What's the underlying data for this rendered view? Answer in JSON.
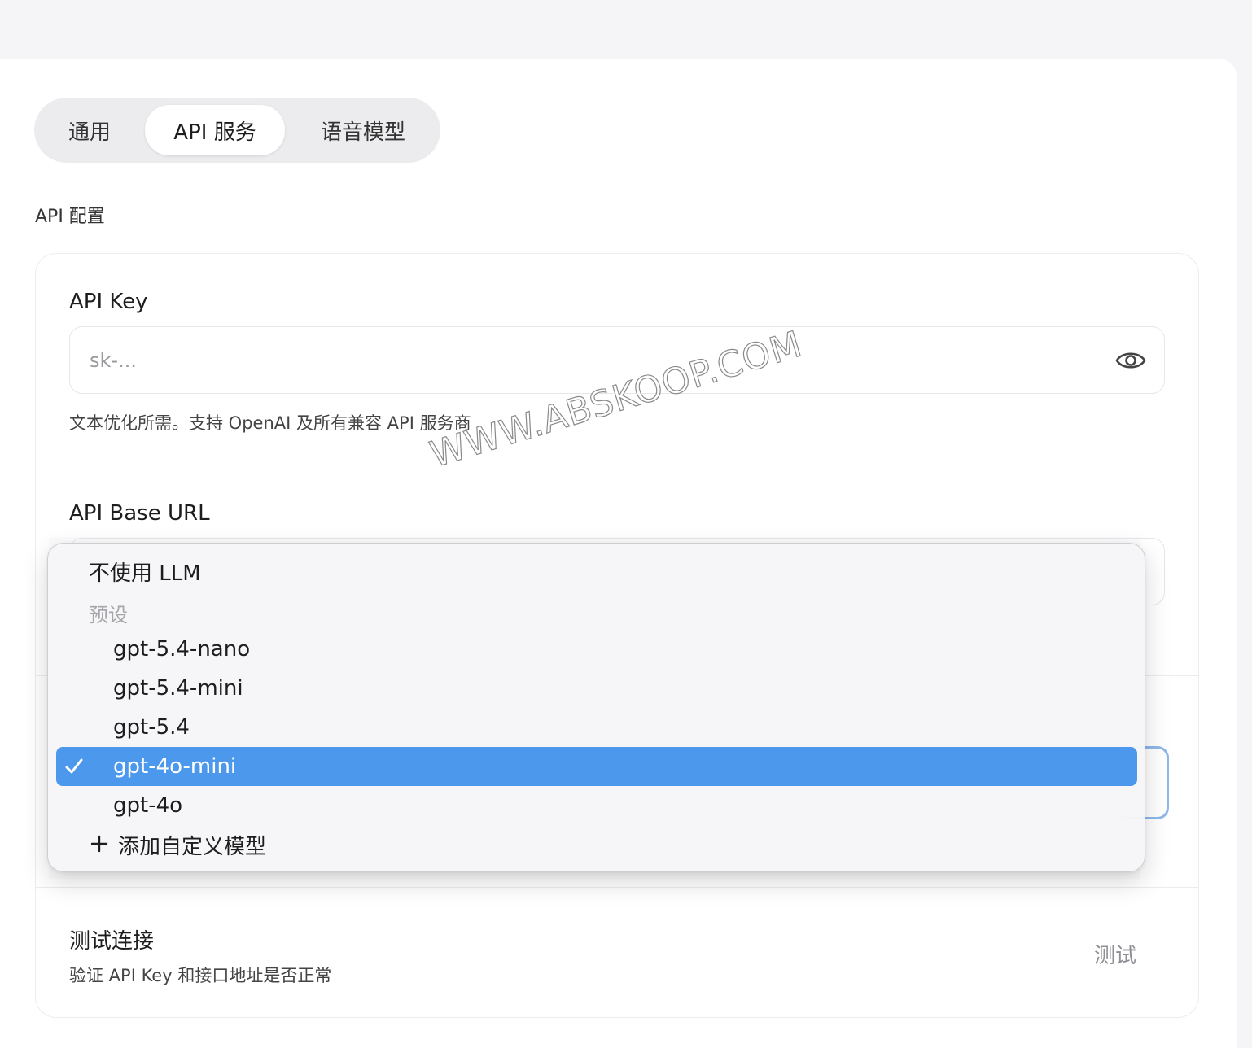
{
  "tabs": [
    {
      "label": "通用",
      "active": false
    },
    {
      "label": "API 服务",
      "active": true
    },
    {
      "label": "语音模型",
      "active": false
    }
  ],
  "section_title": "API 配置",
  "api_key": {
    "label": "API Key",
    "placeholder": "sk-...",
    "value": "",
    "hint": "文本优化所需。支持 OpenAI 及所有兼容 API 服务商",
    "toggle_icon": "eye-icon"
  },
  "base_url": {
    "label": "API Base URL"
  },
  "model_dropdown": {
    "none_option": "不使用 LLM",
    "group_label": "预设",
    "options": [
      "gpt-5.4-nano",
      "gpt-5.4-mini",
      "gpt-5.4",
      "gpt-4o-mini",
      "gpt-4o"
    ],
    "selected": "gpt-4o-mini",
    "add_custom": "添加自定义模型",
    "selected_color": "#4c98ec"
  },
  "test_connection": {
    "label": "测试连接",
    "hint": "验证 API Key 和接口地址是否正常",
    "button": "测试"
  },
  "watermark": "WWW.ABSKOOP.COM"
}
